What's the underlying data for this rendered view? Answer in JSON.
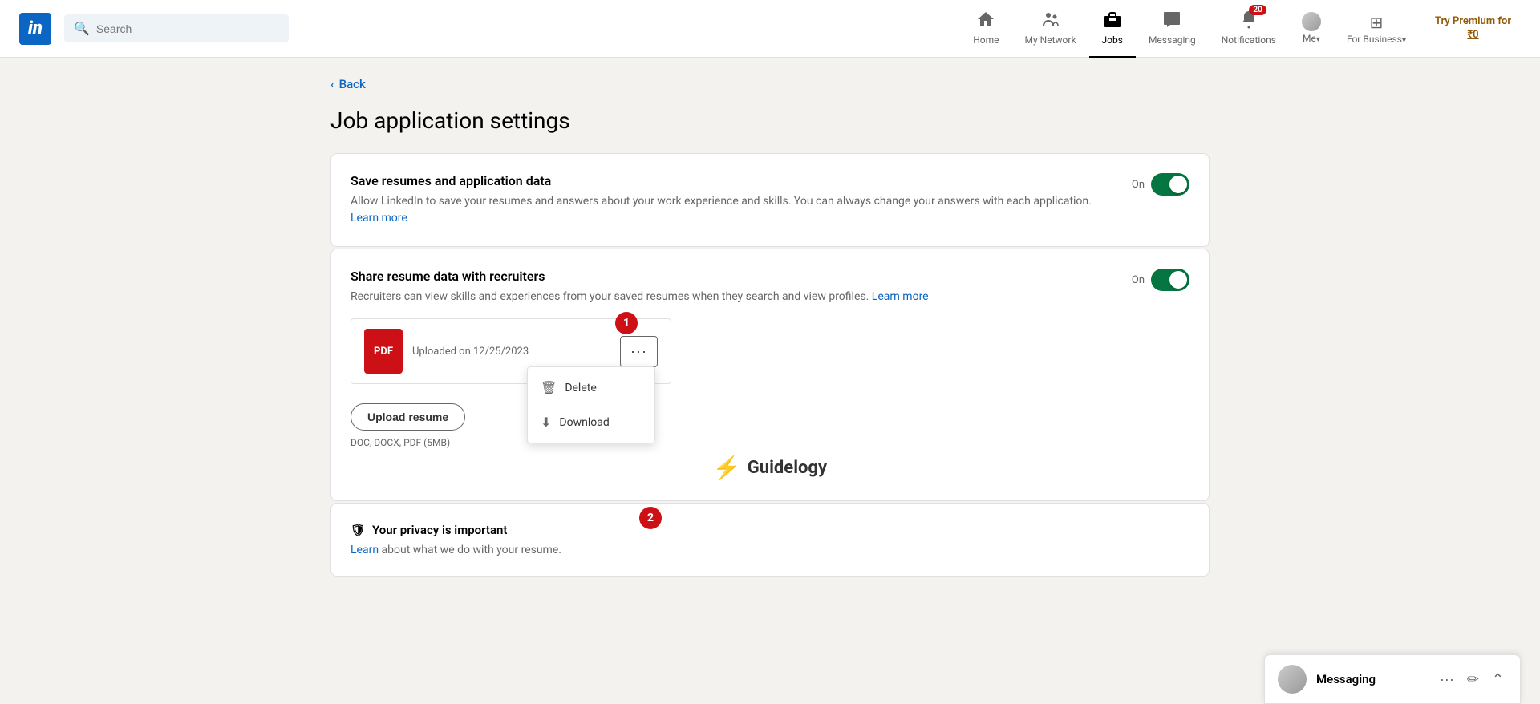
{
  "header": {
    "logo_text": "in",
    "search_placeholder": "Search",
    "nav": {
      "home": {
        "label": "Home",
        "icon": "🏠",
        "badge": null,
        "active": false
      },
      "my_network": {
        "label": "My Network",
        "icon": "👥",
        "badge": null,
        "active": false
      },
      "jobs": {
        "label": "Jobs",
        "icon": "💼",
        "badge": null,
        "active": true
      },
      "messaging": {
        "label": "Messaging",
        "icon": "💬",
        "badge": null,
        "active": false
      },
      "notifications": {
        "label": "Notifications",
        "icon": "🔔",
        "badge": "20",
        "active": false
      },
      "me": {
        "label": "Me",
        "chevron": "▾",
        "active": false
      },
      "for_business": {
        "label": "For Business",
        "chevron": "▾"
      }
    },
    "try_premium": "Try Premium for\n₹0"
  },
  "page": {
    "back_label": "Back",
    "title": "Job application settings",
    "save_resumes": {
      "title": "Save resumes and application data",
      "description": "Allow LinkedIn to save your resumes and answers about your work experience and skills. You can always change your answers with each application.",
      "learn_more": "Learn more",
      "toggle_label": "On",
      "toggle_on": true
    },
    "share_resume": {
      "title": "Share resume data with recruiters",
      "description": "Recruiters can view skills and experiences from your saved resumes when they search and view profiles.",
      "learn_more": "Learn more",
      "toggle_label": "On",
      "toggle_on": true,
      "resume": {
        "pdf_label": "PDF",
        "uploaded_text": "Uploaded on 12/25/2023",
        "more_btn_label": "···"
      },
      "upload_btn": "Upload resume",
      "file_formats": "DOC, DOCX, PDF (5MB)"
    },
    "dropdown": {
      "delete_label": "Delete",
      "download_label": "Download"
    },
    "annotations": {
      "badge1": "1",
      "badge2": "2"
    },
    "privacy": {
      "title": "Your privacy is important",
      "icon": "🛡",
      "description_prefix": "Learn",
      "description_suffix": " about what we do with your resume."
    },
    "watermark": {
      "icon": "⚡",
      "text": "Guidelogy"
    }
  },
  "messaging": {
    "label": "Messaging",
    "actions": {
      "more": "···",
      "compose": "✏",
      "collapse": "⌃"
    }
  }
}
